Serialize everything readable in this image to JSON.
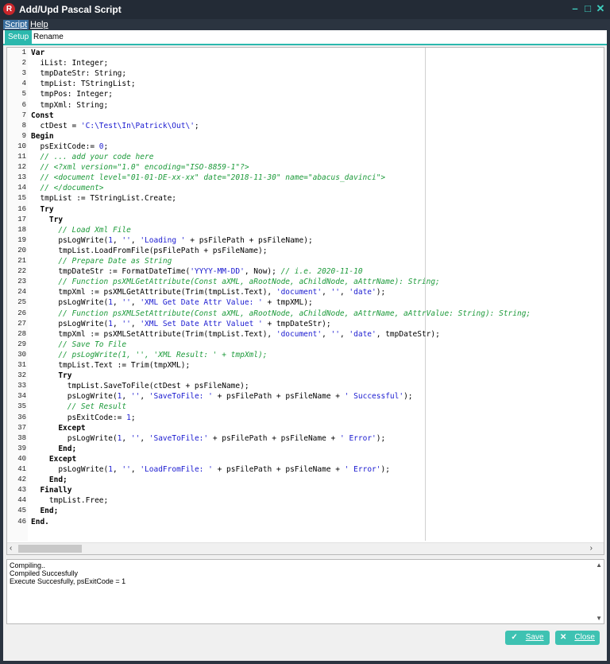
{
  "window": {
    "title": "Add/Upd Pascal Script",
    "app_icon_letter": "R",
    "controls": [
      "minimize-icon",
      "maximize-icon",
      "close-icon"
    ]
  },
  "menu": {
    "script": "Script",
    "help": "Help"
  },
  "tabs": {
    "setup": "Setup",
    "rename": "Rename"
  },
  "editor": {
    "lines": [
      {
        "n": "1",
        "html": "<b>Var</b>"
      },
      {
        "n": "2",
        "html": "  iList: Integer;"
      },
      {
        "n": "3",
        "html": "  tmpDateStr: String;"
      },
      {
        "n": "4",
        "html": "  tmpList: TStringList;"
      },
      {
        "n": "5",
        "html": "  tmpPos: Integer;"
      },
      {
        "n": "6",
        "html": "  tmpXml: String;"
      },
      {
        "n": "7",
        "html": "<b>Const</b>"
      },
      {
        "n": "8",
        "html": "  ctDest = <span class=\"s\">'C:\\Test\\In\\Patrick\\Out\\'</span>;"
      },
      {
        "n": "9",
        "html": "<b>Begin</b>"
      },
      {
        "n": "10",
        "html": "  psExitCode:= <span class=\"n\">0</span>;"
      },
      {
        "n": "11",
        "html": "  <span class=\"c\">// ... add your code here</span>"
      },
      {
        "n": "12",
        "html": "  <span class=\"c\">// &lt;?xml version=\"1.0\" encoding=\"ISO-8859-1\"?&gt;</span>"
      },
      {
        "n": "13",
        "html": "  <span class=\"c\">// &lt;document level=\"01-01-DE-xx-xx\" date=\"2018-11-30\" name=\"abacus_davinci\"&gt;</span>"
      },
      {
        "n": "14",
        "html": "  <span class=\"c\">// &lt;/document&gt;</span>"
      },
      {
        "n": "15",
        "html": "  tmpList := TStringList.Create;"
      },
      {
        "n": "16",
        "html": "  <b>Try</b>"
      },
      {
        "n": "17",
        "html": "    <b>Try</b>"
      },
      {
        "n": "18",
        "html": "      <span class=\"c\">// Load Xml File</span>"
      },
      {
        "n": "19",
        "html": "      psLogWrite(<span class=\"n\">1</span>, <span class=\"s\">''</span>, <span class=\"s\">'Loading '</span> + psFilePath + psFileName);"
      },
      {
        "n": "20",
        "html": "      tmpList.LoadFromFile(psFilePath + psFileName);"
      },
      {
        "n": "21",
        "html": "      <span class=\"c\">// Prepare Date as String</span>"
      },
      {
        "n": "22",
        "html": "      tmpDateStr := FormatDateTime(<span class=\"s\">'YYYY-MM-DD'</span>, Now); <span class=\"c\">// i.e. 2020-11-10</span>"
      },
      {
        "n": "23",
        "html": "      <span class=\"c\">// Function psXMLGetAttribute(Const aXML, aRootNode, aChildNode, aAttrName): String;</span>"
      },
      {
        "n": "24",
        "html": "      tmpXml := psXMLGetAttribute(Trim(tmpList.Text), <span class=\"s\">'document'</span>, <span class=\"s\">''</span>, <span class=\"s\">'date'</span>);"
      },
      {
        "n": "25",
        "html": "      psLogWrite(<span class=\"n\">1</span>, <span class=\"s\">''</span>, <span class=\"s\">'XML Get Date Attr Value: '</span> + tmpXML);"
      },
      {
        "n": "26",
        "html": "      <span class=\"c\">// Function psXMLSetAttribute(Const aXML, aRootNode, aChildNode, aAttrName, aAttrValue: String): String;</span>"
      },
      {
        "n": "27",
        "html": "      psLogWrite(<span class=\"n\">1</span>, <span class=\"s\">''</span>, <span class=\"s\">'XML Set Date Attr Valuet '</span> + tmpDateStr);"
      },
      {
        "n": "28",
        "html": "      tmpXml := psXMLSetAttribute(Trim(tmpList.Text), <span class=\"s\">'document'</span>, <span class=\"s\">''</span>, <span class=\"s\">'date'</span>, tmpDateStr);"
      },
      {
        "n": "29",
        "html": "      <span class=\"c\">// Save To File</span>"
      },
      {
        "n": "30",
        "html": "      <span class=\"c\">// psLogWrite(1, '', 'XML Result: ' + tmpXml);</span>"
      },
      {
        "n": "31",
        "html": "      tmpList.Text := Trim(tmpXML);"
      },
      {
        "n": "32",
        "html": "      <b>Try</b>"
      },
      {
        "n": "33",
        "html": "        tmpList.SaveToFile(ctDest + psFileName);"
      },
      {
        "n": "34",
        "html": "        psLogWrite(<span class=\"n\">1</span>, <span class=\"s\">''</span>, <span class=\"s\">'SaveToFile: '</span> + psFilePath + psFileName + <span class=\"s\">' Successful'</span>);"
      },
      {
        "n": "35",
        "html": "        <span class=\"c\">// Set Result</span>"
      },
      {
        "n": "36",
        "html": "        psExitCode:= <span class=\"n\">1</span>;"
      },
      {
        "n": "37",
        "html": "      <b>Except</b>"
      },
      {
        "n": "38",
        "html": "        psLogWrite(<span class=\"n\">1</span>, <span class=\"s\">''</span>, <span class=\"s\">'SaveToFile:'</span> + psFilePath + psFileName + <span class=\"s\">' Error'</span>);"
      },
      {
        "n": "39",
        "html": "      <b>End;</b>"
      },
      {
        "n": "40",
        "html": "    <b>Except</b>"
      },
      {
        "n": "41",
        "html": "      psLogWrite(<span class=\"n\">1</span>, <span class=\"s\">''</span>, <span class=\"s\">'LoadFromFile: '</span> + psFilePath + psFileName + <span class=\"s\">' Error'</span>);"
      },
      {
        "n": "42",
        "html": "    <b>End;</b>"
      },
      {
        "n": "43",
        "html": "  <b>Finally</b>"
      },
      {
        "n": "44",
        "html": "    tmpList.Free;"
      },
      {
        "n": "45",
        "html": "  <b>End;</b>"
      },
      {
        "n": "46",
        "html": "<b>End.</b>"
      }
    ]
  },
  "output": {
    "lines": [
      "Compiling..",
      "Compiled Succesfully",
      "Execute Succesfully, psExitCode = 1"
    ]
  },
  "buttons": {
    "save": "Save",
    "close": "Close"
  },
  "colors": {
    "accent": "#3ec2b2",
    "titlebar": "#232b36"
  }
}
